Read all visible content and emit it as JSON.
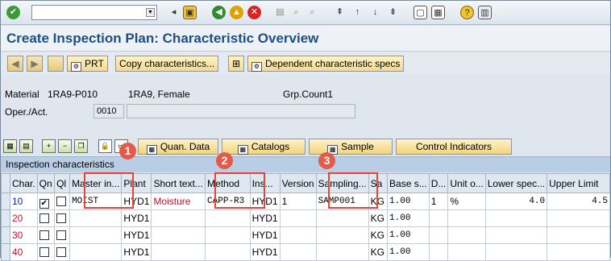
{
  "toolbar": {
    "command_field_value": "",
    "icons": [
      "check-icon",
      "save-icon",
      "back-icon",
      "exit-icon",
      "cancel-icon",
      "print-icon",
      "find-icon",
      "find-next-icon",
      "first-page-icon",
      "prev-page-icon",
      "next-page-icon",
      "last-page-icon",
      "new-session-icon",
      "shortcut-icon",
      "help-icon",
      "customize-icon"
    ]
  },
  "title": "Create Inspection Plan: Characteristic Overview",
  "appbar": {
    "prt_label": "PRT",
    "copy_label": "Copy  characteristics...",
    "dependent_label": "Dependent characteristic specs"
  },
  "header": {
    "material_label": "Material",
    "material_value": "1RA9-P010",
    "material_desc": "1RA9, Female",
    "grpcount_label": "Grp.Count1",
    "operact_label": "Oper./Act.",
    "operact_value": "0010",
    "operact_desc": ""
  },
  "tabs": {
    "quan_data": "Quan. Data",
    "catalogs": "Catalogs",
    "sample": "Sample",
    "control_indicators": "Control Indicators"
  },
  "grid": {
    "title": "Inspection characteristics",
    "columns": [
      "Char.",
      "Qn",
      "Ql",
      "Master in...",
      "Plant",
      "Short text...",
      "Method",
      "Ins...",
      "Version",
      "Sampling...",
      "Sa",
      "Base s...",
      "D...",
      "Unit o...",
      "Lower spec...",
      "Upper Limit"
    ],
    "rows": [
      {
        "char": "10",
        "qn": true,
        "ql": false,
        "master": "MOIST",
        "plant": "HYD1",
        "short": "Moisture",
        "method": "CAPP-R3",
        "ins": "HYD1",
        "version": "1",
        "sampling": "SAMP001",
        "sa": "KG",
        "base": "1.00",
        "d": "1",
        "unit": "%",
        "lower": "4.0",
        "upper": "4.5"
      },
      {
        "char": "20",
        "qn": false,
        "ql": false,
        "master": "",
        "plant": "HYD1",
        "short": "",
        "method": "",
        "ins": "HYD1",
        "version": "",
        "sampling": "",
        "sa": "KG",
        "base": "1.00",
        "d": "",
        "unit": "",
        "lower": "",
        "upper": ""
      },
      {
        "char": "30",
        "qn": false,
        "ql": false,
        "master": "",
        "plant": "HYD1",
        "short": "",
        "method": "",
        "ins": "HYD1",
        "version": "",
        "sampling": "",
        "sa": "KG",
        "base": "1.00",
        "d": "",
        "unit": "",
        "lower": "",
        "upper": ""
      },
      {
        "char": "40",
        "qn": false,
        "ql": false,
        "master": "",
        "plant": "HYD1",
        "short": "",
        "method": "",
        "ins": "HYD1",
        "version": "",
        "sampling": "",
        "sa": "KG",
        "base": "1.00",
        "d": "",
        "unit": "",
        "lower": "",
        "upper": ""
      }
    ]
  },
  "annotations": {
    "one": "1",
    "two": "2",
    "three": "3"
  },
  "colors": {
    "highlight": "#e0463c",
    "title_blue": "#1d4f84",
    "row_red": "#c0142a",
    "row_blue": "#0026b5"
  }
}
